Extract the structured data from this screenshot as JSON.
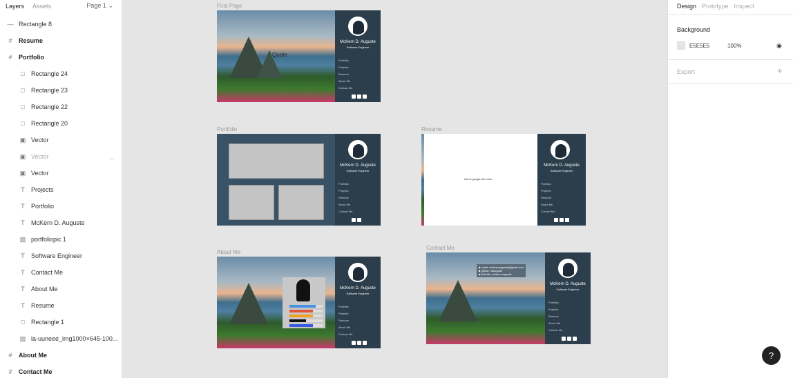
{
  "left_panel": {
    "tabs": [
      "Layers",
      "Assets"
    ],
    "page": "Page 1",
    "layers": [
      {
        "label": "Rectangle 8",
        "icon": "line-icon",
        "level": "top",
        "bold": false
      },
      {
        "label": "Resume",
        "icon": "frame-icon",
        "level": "top",
        "bold": true
      },
      {
        "label": "Portfolio",
        "icon": "frame-icon",
        "level": "top",
        "bold": true
      },
      {
        "label": "Rectangle 24",
        "icon": "rect-icon",
        "level": "child"
      },
      {
        "label": "Rectangle 23",
        "icon": "rect-icon",
        "level": "child"
      },
      {
        "label": "Rectangle 22",
        "icon": "rect-icon",
        "level": "child"
      },
      {
        "label": "Rectangle 20",
        "icon": "rect-icon",
        "level": "child"
      },
      {
        "label": "Vector",
        "icon": "vector-icon",
        "level": "child"
      },
      {
        "label": "Vector",
        "icon": "vector-icon",
        "level": "child",
        "hidden": true
      },
      {
        "label": "Vector",
        "icon": "vector-icon",
        "level": "child"
      },
      {
        "label": "Projects",
        "icon": "text-icon",
        "level": "child"
      },
      {
        "label": "Portfolio",
        "icon": "text-icon",
        "level": "child"
      },
      {
        "label": "McKern D. Auguste",
        "icon": "text-icon",
        "level": "child"
      },
      {
        "label": "portfoliopic 1",
        "icon": "image-icon",
        "level": "child"
      },
      {
        "label": "Software Engineer",
        "icon": "text-icon",
        "level": "child"
      },
      {
        "label": "Contact Me",
        "icon": "text-icon",
        "level": "child"
      },
      {
        "label": "About Me",
        "icon": "text-icon",
        "level": "child"
      },
      {
        "label": "Resume",
        "icon": "text-icon",
        "level": "child"
      },
      {
        "label": "Rectangle 1",
        "icon": "rect-icon",
        "level": "child"
      },
      {
        "label": "la-uuneee_img1000×645-100...",
        "icon": "image-icon",
        "level": "child"
      },
      {
        "label": "About Me",
        "icon": "frame-icon",
        "level": "top",
        "bold": true
      },
      {
        "label": "Contact Me",
        "icon": "frame-icon",
        "level": "top",
        "bold": true
      }
    ]
  },
  "canvas": {
    "frames": {
      "first_page": "First Page",
      "portfolio": "Portfolio",
      "resume": "Resume",
      "about_me": "About Me",
      "contact_me": "Contact Me"
    },
    "quote": "Quote",
    "resume_note": "link to google doc view",
    "profile": {
      "name": "McKern D. Auguste",
      "role": "Software Engineer",
      "nav": [
        "Portfolio",
        "Projects",
        "Resume",
        "About Me",
        "Contact Me"
      ]
    },
    "contact_lines": [
      "email: mckernauguste@gmail.com",
      "github: mauguste",
      "linkedin: mckern auguste"
    ],
    "skills": [
      {
        "fill": 0.8,
        "color": "#4a90e2"
      },
      {
        "fill": 0.7,
        "color": "#e2553d"
      },
      {
        "fill": 0.7,
        "color": "#f0a020"
      },
      {
        "fill": 0.5,
        "color": "#111111"
      },
      {
        "fill": 0.7,
        "color": "#3a5adf"
      }
    ]
  },
  "right_panel": {
    "tabs": [
      "Design",
      "Prototype",
      "Inspect"
    ],
    "background_label": "Background",
    "background_hex": "E5E5E5",
    "background_opacity": "100%",
    "export_label": "Export",
    "help": "?"
  },
  "colors": {
    "canvas_bg": "#e5e5e5",
    "sidebar": "#2c3e4c"
  }
}
